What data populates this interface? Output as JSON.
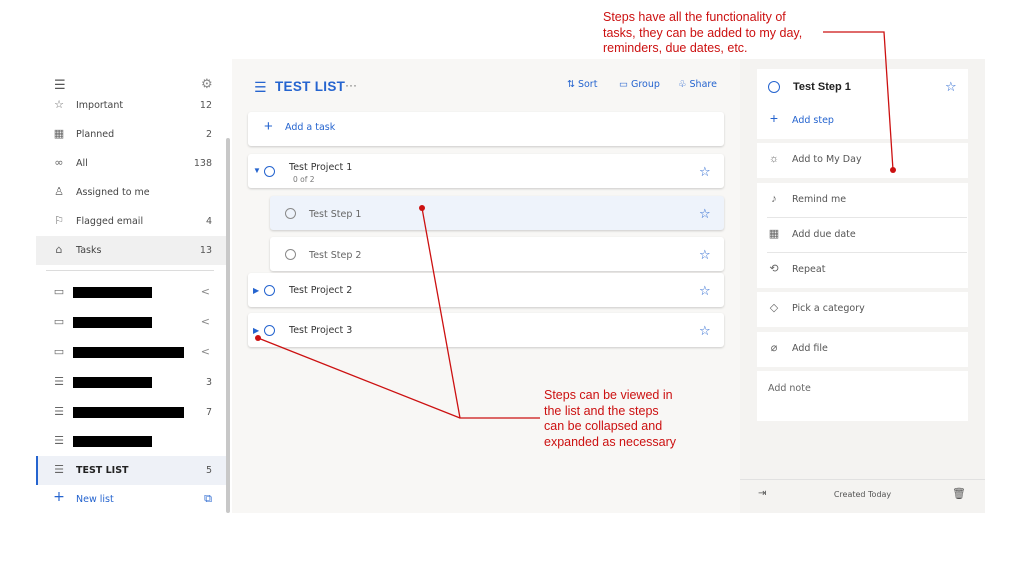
{
  "sidebar": {
    "items": [
      {
        "icon": "star-icon",
        "glyph": "☆",
        "label": "Important",
        "count": "12"
      },
      {
        "icon": "calendar-icon",
        "glyph": "▦",
        "label": "Planned",
        "count": "2"
      },
      {
        "icon": "infinity-icon",
        "glyph": "∞",
        "label": "All",
        "count": "138"
      },
      {
        "icon": "person-icon",
        "glyph": "♙",
        "label": "Assigned to me",
        "count": ""
      },
      {
        "icon": "flag-icon",
        "glyph": "⚐",
        "label": "Flagged email",
        "count": "4"
      },
      {
        "icon": "home-icon",
        "glyph": "⌂",
        "label": "Tasks",
        "count": "13"
      }
    ],
    "groups": [
      {
        "icon": "group-icon",
        "glyph": "▭",
        "count": "",
        "chevron": "<"
      },
      {
        "icon": "group-icon",
        "glyph": "▭",
        "count": "",
        "chevron": "<"
      },
      {
        "icon": "group-icon",
        "glyph": "▭",
        "count": "",
        "chevron": "<"
      },
      {
        "icon": "list-icon",
        "glyph": "☰",
        "count": "3",
        "chevron": ""
      },
      {
        "icon": "list-icon",
        "glyph": "☰",
        "count": "7",
        "chevron": ""
      },
      {
        "icon": "list-icon",
        "glyph": "☰",
        "count": "",
        "chevron": ""
      }
    ],
    "active_list": {
      "label": "TEST LIST",
      "count": "5"
    },
    "new_list_label": "New list"
  },
  "main": {
    "title": "TEST LIST",
    "more": "···",
    "tools": {
      "sort": "Sort",
      "group": "Group",
      "share": "Share"
    },
    "add_task_label": "Add a task",
    "tasks": [
      {
        "title": "Test Project 1",
        "sub": "0 of 2",
        "expanded": true,
        "toggle": "▼"
      },
      {
        "title": "Test Step 1",
        "step": true
      },
      {
        "title": "Test Step 2",
        "step": true
      },
      {
        "title": "Test Project 2",
        "toggle": "▶"
      },
      {
        "title": "Test Project 3",
        "toggle": "▶"
      }
    ]
  },
  "detail": {
    "title": "Test Step 1",
    "add_step": "Add step",
    "add_to_my_day": "Add to My Day",
    "remind_me": "Remind me",
    "add_due_date": "Add due date",
    "repeat": "Repeat",
    "pick_category": "Pick a category",
    "add_file": "Add file",
    "add_note": "Add note",
    "created": "Created Today"
  },
  "annotations": {
    "top": [
      "Steps have all the functionality of",
      "tasks, they can be added to my day,",
      "reminders, due dates, etc."
    ],
    "middle": [
      "Steps can be viewed in",
      "the list and the steps",
      "can be collapsed and",
      "expanded as necessary"
    ]
  },
  "colors": {
    "accent": "#2564cf",
    "annotation": "#cc1111"
  }
}
